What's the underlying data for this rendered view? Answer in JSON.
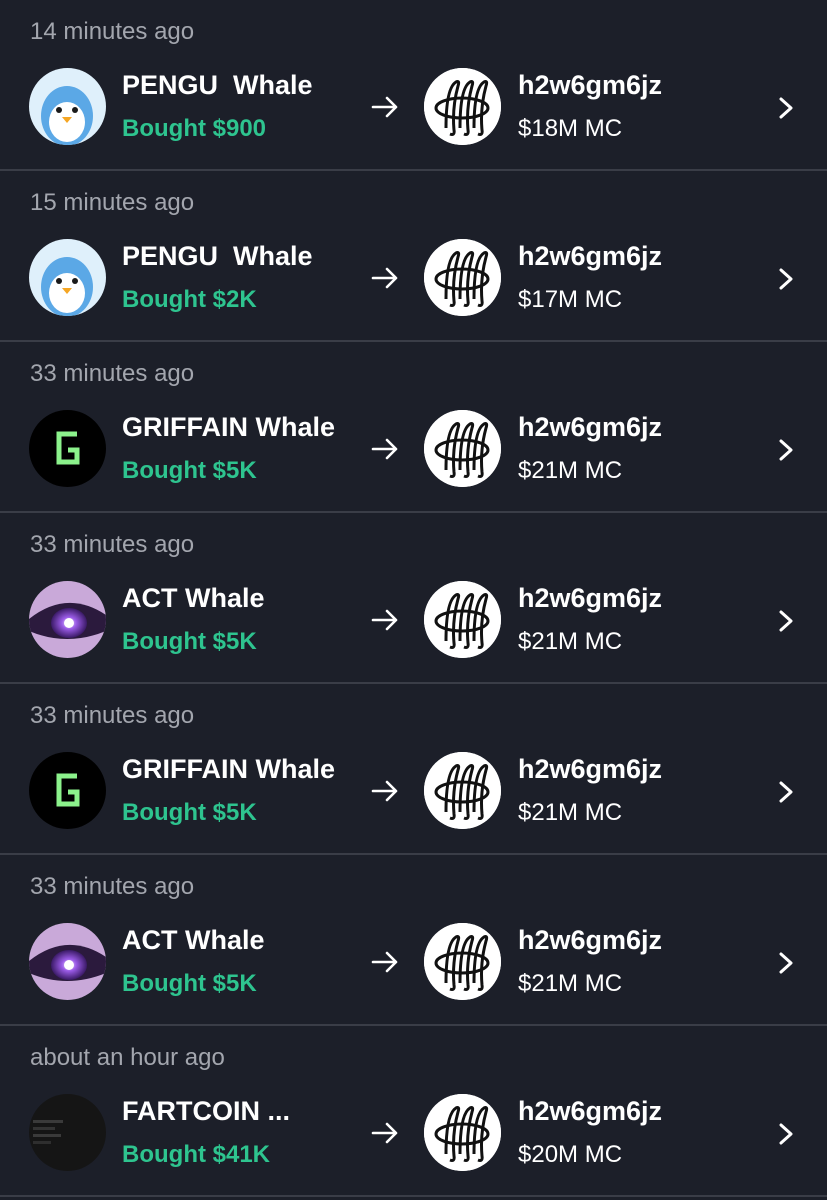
{
  "colors": {
    "background": "#1c1f29",
    "divider": "#3a3d47",
    "bought_green": "#2ec48f",
    "muted_text": "#a3a6ae"
  },
  "feed": [
    {
      "time": "14 minutes ago",
      "whale": "PENGU  Whale",
      "avatar": "pengu-penguin-avatar",
      "bought": "Bought $900",
      "token": "h2w6gm6jz",
      "mc": "$18M MC"
    },
    {
      "time": "15 minutes ago",
      "whale": "PENGU  Whale",
      "avatar": "pengu-penguin-avatar",
      "bought": "Bought $2K",
      "token": "h2w6gm6jz",
      "mc": "$17M MC"
    },
    {
      "time": "33 minutes ago",
      "whale": "GRIFFAIN Whale",
      "avatar": "griffain-g-avatar",
      "bought": "Bought $5K",
      "token": "h2w6gm6jz",
      "mc": "$21M MC"
    },
    {
      "time": "33 minutes ago",
      "whale": "ACT Whale",
      "avatar": "act-purple-eye-avatar",
      "bought": "Bought $5K",
      "token": "h2w6gm6jz",
      "mc": "$21M MC"
    },
    {
      "time": "33 minutes ago",
      "whale": "GRIFFAIN Whale",
      "avatar": "griffain-g-avatar",
      "bought": "Bought $5K",
      "token": "h2w6gm6jz",
      "mc": "$21M MC"
    },
    {
      "time": "33 minutes ago",
      "whale": "ACT Whale",
      "avatar": "act-purple-eye-avatar",
      "bought": "Bought $5K",
      "token": "h2w6gm6jz",
      "mc": "$21M MC"
    },
    {
      "time": "about an hour ago",
      "whale": "FARTCOIN ...",
      "avatar": "fartcoin-dark-avatar",
      "bought": "Bought $41K",
      "token": "h2w6gm6jz",
      "mc": "$20M MC"
    }
  ]
}
